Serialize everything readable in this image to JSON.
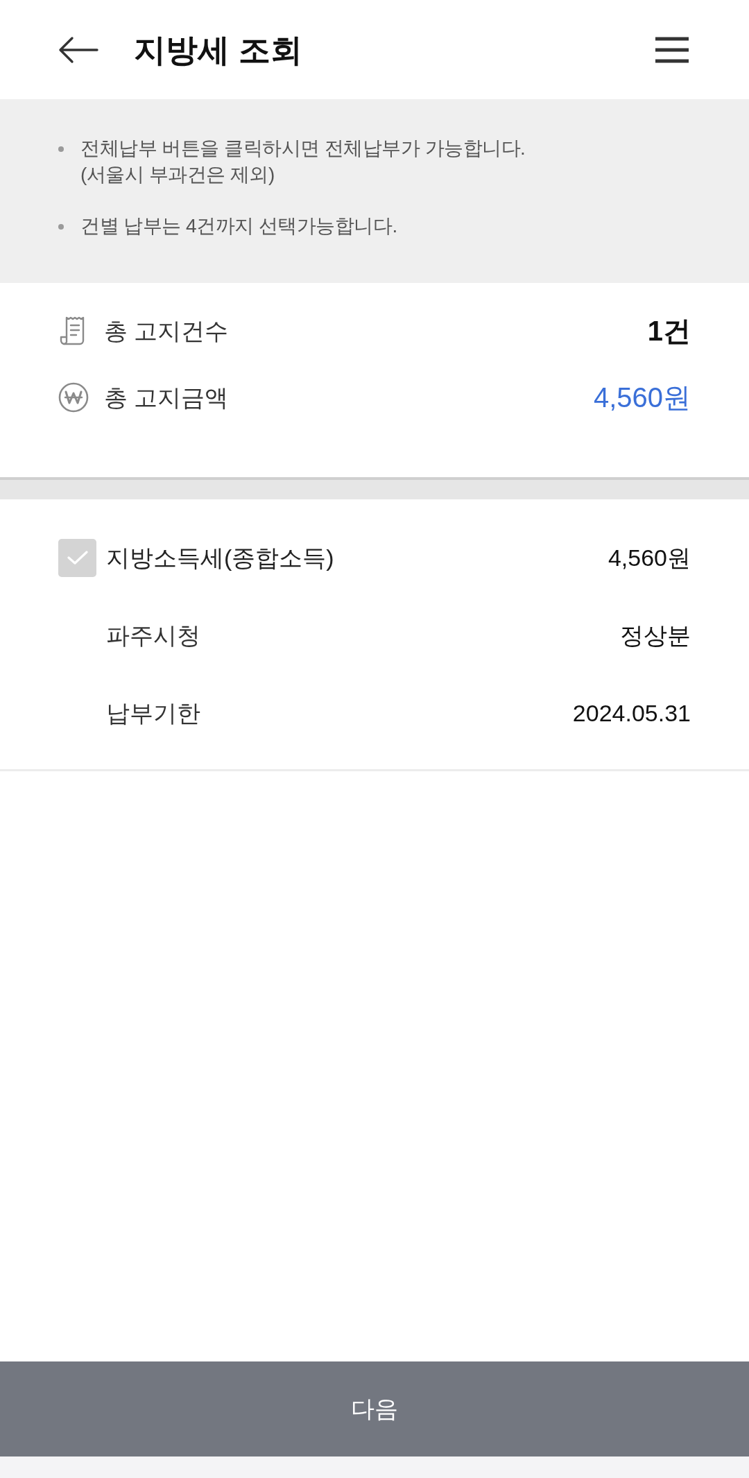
{
  "header": {
    "title": "지방세 조회"
  },
  "notices": [
    {
      "text": "전체납부 버튼을 클릭하시면 전체납부가 가능합니다.\n(서울시 부과건은 제외)"
    },
    {
      "text": "건별 납부는 4건까지 선택가능합니다."
    }
  ],
  "summary": [
    {
      "kind": "receipt",
      "label": "총 고지건수",
      "value": "1건",
      "highlight": false
    },
    {
      "kind": "won",
      "label": "총 고지금액",
      "value": "4,560원",
      "highlight": true
    }
  ],
  "item": {
    "checked": true,
    "disabled": true,
    "name": "지방소득세(종합소득)",
    "amount": "4,560원",
    "details": [
      {
        "label": "파주시청",
        "value": "정상분"
      },
      {
        "label": "납부기한",
        "value": "2024.05.31"
      }
    ]
  },
  "next_button": {
    "label": "다음"
  }
}
